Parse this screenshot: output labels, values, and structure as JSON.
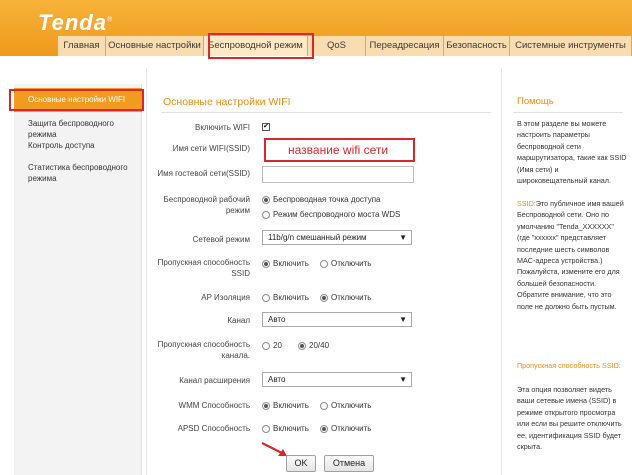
{
  "brand": {
    "name": "Tenda",
    "reg": "®"
  },
  "nav": {
    "tabs": [
      "Главная",
      "Основные настройки",
      "Беспроводной режим",
      "QoS",
      "Переадресация",
      "Безопасность",
      "Системные инструменты"
    ]
  },
  "sidebar": {
    "items": [
      "Основные настройки WIFI",
      "Защита беспроводного режима",
      "Контроль доступа",
      "Статистика беспроводного режима"
    ]
  },
  "main": {
    "title": "Основные настройки WIFI",
    "enable_wifi_label": "Включить WIFI",
    "enable_wifi_checked": "✔",
    "ssid_label": "Имя сети WIFI(SSID)",
    "ssid_value": "название wifi сети",
    "guest_ssid_label": "Имя гостевой сети(SSID)",
    "guest_ssid_value": "",
    "wireless_mode_label": "Беспроводной рабочий режим",
    "wireless_mode_options": [
      "Беспроводная точка доступа",
      "Режим беспроводного моста WDS"
    ],
    "network_mode_label": "Сетевой режим",
    "network_mode_value": "11b/g/n смешанный режим",
    "ssid_broadcast_label": "Пропускная способность SSID",
    "ap_isolation_label": "AP Изоляция",
    "channel_label": "Канал",
    "channel_value": "Авто",
    "bandwidth_label": "Пропускная способность канала.",
    "bandwidth_options": [
      "20",
      "20/40"
    ],
    "ext_channel_label": "Канал расширения",
    "ext_channel_value": "Авто",
    "wmm_label": "WMM Способность",
    "apsd_label": "APSD Способность",
    "on_label": "Включить",
    "off_label": "Отключить",
    "ok_label": "OK",
    "cancel_label": "Отмена"
  },
  "help": {
    "title": "Помощь",
    "intro": "В этом разделе вы можете настроить параметры беспроводной сети маршрутизатора, такие как SSID (Имя сети) и широковещательный канал.",
    "ssid_term": "SSID:",
    "ssid_text": "Это публичное имя вашей Беспроводной сети. Оно по умолчанию \"Tenda_XXXXXX\" (где \"xxxxxx\" представляет последние шесть символов MAC-адреса устройства.) Пожалуйста, измените его для большей безопасности. Обратите внимание, что это поле не должно быть пустым.",
    "broadcast_term": "Пропускная способность SSID:",
    "broadcast_text": "Эта опция позволяет видеть ваши сетевые имена (SSID) в режиме открытого просмотра или если вы решите отключить ее, идентификация SSID будет скрыта."
  },
  "colors": {
    "accent": "#f19b1f",
    "highlight_box": "#d9272b",
    "title": "#f08c13"
  }
}
